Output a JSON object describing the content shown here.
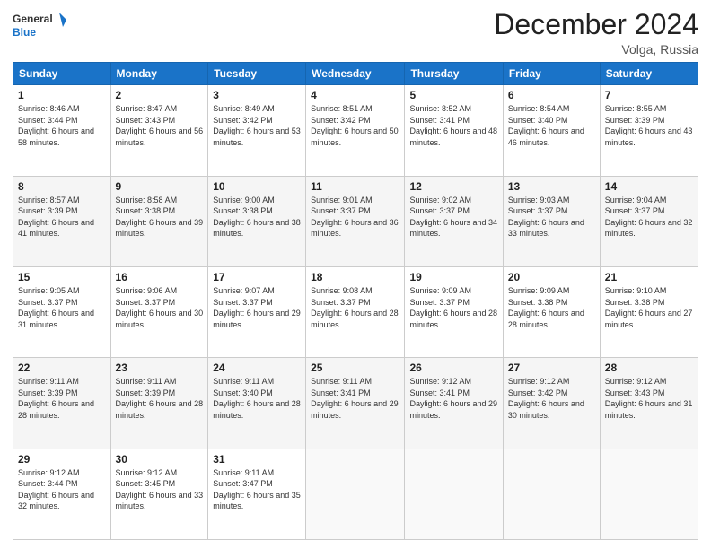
{
  "logo": {
    "line1": "General",
    "line2": "Blue"
  },
  "title": "December 2024",
  "subtitle": "Volga, Russia",
  "header": {
    "colors": {
      "bg": "#1a73c8"
    }
  },
  "days_of_week": [
    "Sunday",
    "Monday",
    "Tuesday",
    "Wednesday",
    "Thursday",
    "Friday",
    "Saturday"
  ],
  "weeks": [
    [
      {
        "day": "1",
        "sunrise": "8:46 AM",
        "sunset": "3:44 PM",
        "daylight": "6 hours and 58 minutes."
      },
      {
        "day": "2",
        "sunrise": "8:47 AM",
        "sunset": "3:43 PM",
        "daylight": "6 hours and 56 minutes."
      },
      {
        "day": "3",
        "sunrise": "8:49 AM",
        "sunset": "3:42 PM",
        "daylight": "6 hours and 53 minutes."
      },
      {
        "day": "4",
        "sunrise": "8:51 AM",
        "sunset": "3:42 PM",
        "daylight": "6 hours and 50 minutes."
      },
      {
        "day": "5",
        "sunrise": "8:52 AM",
        "sunset": "3:41 PM",
        "daylight": "6 hours and 48 minutes."
      },
      {
        "day": "6",
        "sunrise": "8:54 AM",
        "sunset": "3:40 PM",
        "daylight": "6 hours and 46 minutes."
      },
      {
        "day": "7",
        "sunrise": "8:55 AM",
        "sunset": "3:39 PM",
        "daylight": "6 hours and 43 minutes."
      }
    ],
    [
      {
        "day": "8",
        "sunrise": "8:57 AM",
        "sunset": "3:39 PM",
        "daylight": "6 hours and 41 minutes."
      },
      {
        "day": "9",
        "sunrise": "8:58 AM",
        "sunset": "3:38 PM",
        "daylight": "6 hours and 39 minutes."
      },
      {
        "day": "10",
        "sunrise": "9:00 AM",
        "sunset": "3:38 PM",
        "daylight": "6 hours and 38 minutes."
      },
      {
        "day": "11",
        "sunrise": "9:01 AM",
        "sunset": "3:37 PM",
        "daylight": "6 hours and 36 minutes."
      },
      {
        "day": "12",
        "sunrise": "9:02 AM",
        "sunset": "3:37 PM",
        "daylight": "6 hours and 34 minutes."
      },
      {
        "day": "13",
        "sunrise": "9:03 AM",
        "sunset": "3:37 PM",
        "daylight": "6 hours and 33 minutes."
      },
      {
        "day": "14",
        "sunrise": "9:04 AM",
        "sunset": "3:37 PM",
        "daylight": "6 hours and 32 minutes."
      }
    ],
    [
      {
        "day": "15",
        "sunrise": "9:05 AM",
        "sunset": "3:37 PM",
        "daylight": "6 hours and 31 minutes."
      },
      {
        "day": "16",
        "sunrise": "9:06 AM",
        "sunset": "3:37 PM",
        "daylight": "6 hours and 30 minutes."
      },
      {
        "day": "17",
        "sunrise": "9:07 AM",
        "sunset": "3:37 PM",
        "daylight": "6 hours and 29 minutes."
      },
      {
        "day": "18",
        "sunrise": "9:08 AM",
        "sunset": "3:37 PM",
        "daylight": "6 hours and 28 minutes."
      },
      {
        "day": "19",
        "sunrise": "9:09 AM",
        "sunset": "3:37 PM",
        "daylight": "6 hours and 28 minutes."
      },
      {
        "day": "20",
        "sunrise": "9:09 AM",
        "sunset": "3:38 PM",
        "daylight": "6 hours and 28 minutes."
      },
      {
        "day": "21",
        "sunrise": "9:10 AM",
        "sunset": "3:38 PM",
        "daylight": "6 hours and 27 minutes."
      }
    ],
    [
      {
        "day": "22",
        "sunrise": "9:11 AM",
        "sunset": "3:39 PM",
        "daylight": "6 hours and 28 minutes."
      },
      {
        "day": "23",
        "sunrise": "9:11 AM",
        "sunset": "3:39 PM",
        "daylight": "6 hours and 28 minutes."
      },
      {
        "day": "24",
        "sunrise": "9:11 AM",
        "sunset": "3:40 PM",
        "daylight": "6 hours and 28 minutes."
      },
      {
        "day": "25",
        "sunrise": "9:11 AM",
        "sunset": "3:41 PM",
        "daylight": "6 hours and 29 minutes."
      },
      {
        "day": "26",
        "sunrise": "9:12 AM",
        "sunset": "3:41 PM",
        "daylight": "6 hours and 29 minutes."
      },
      {
        "day": "27",
        "sunrise": "9:12 AM",
        "sunset": "3:42 PM",
        "daylight": "6 hours and 30 minutes."
      },
      {
        "day": "28",
        "sunrise": "9:12 AM",
        "sunset": "3:43 PM",
        "daylight": "6 hours and 31 minutes."
      }
    ],
    [
      {
        "day": "29",
        "sunrise": "9:12 AM",
        "sunset": "3:44 PM",
        "daylight": "6 hours and 32 minutes."
      },
      {
        "day": "30",
        "sunrise": "9:12 AM",
        "sunset": "3:45 PM",
        "daylight": "6 hours and 33 minutes."
      },
      {
        "day": "31",
        "sunrise": "9:11 AM",
        "sunset": "3:47 PM",
        "daylight": "6 hours and 35 minutes."
      },
      null,
      null,
      null,
      null
    ]
  ]
}
